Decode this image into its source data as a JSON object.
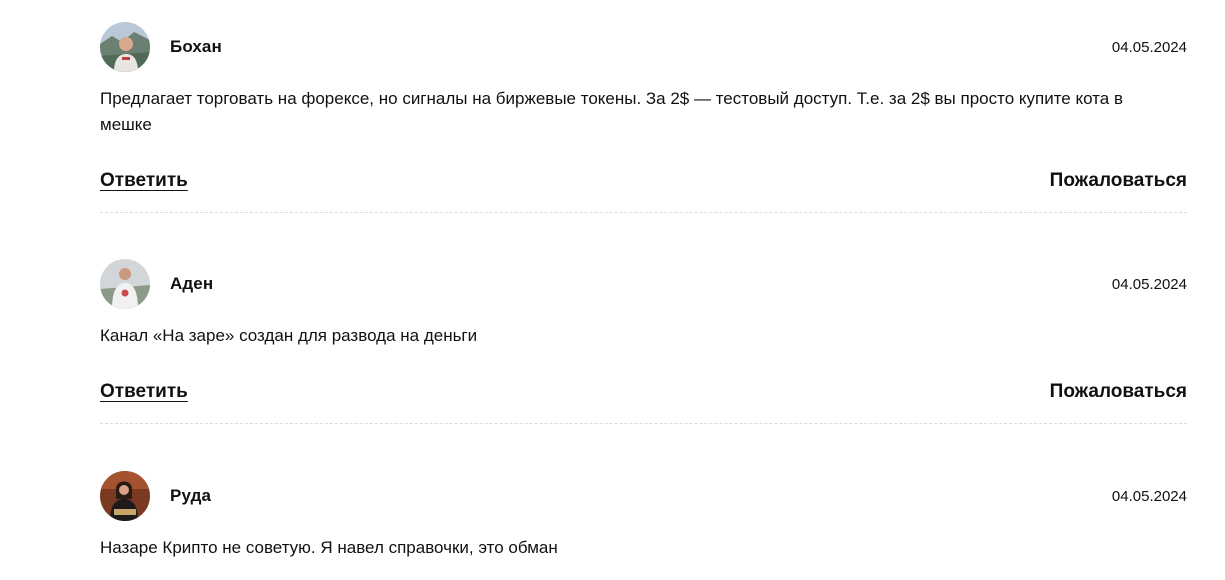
{
  "comments": [
    {
      "author": "Бохан",
      "date": "04.05.2024",
      "text": "Предлагает торговать на форексе, но сигналы на биржевые токены. За 2$ — тестовый доступ. Т.е. за 2$ вы просто купите кота в мешке",
      "reply_label": "Ответить",
      "complain_label": "Пожаловаться",
      "avatar_icon": "user-photo-avatar-icon"
    },
    {
      "author": "Аден",
      "date": "04.05.2024",
      "text": "Канал «На заре» создан для развода на деньги",
      "reply_label": "Ответить",
      "complain_label": "Пожаловаться",
      "avatar_icon": "user-photo-avatar-icon"
    },
    {
      "author": "Руда",
      "date": "04.05.2024",
      "text": "Назаре Крипто не советую. Я навел справочки, это обман",
      "avatar_icon": "user-photo-avatar-icon"
    }
  ],
  "colors": {
    "text": "#111111",
    "divider": "#dcdcdc",
    "background": "#ffffff"
  }
}
